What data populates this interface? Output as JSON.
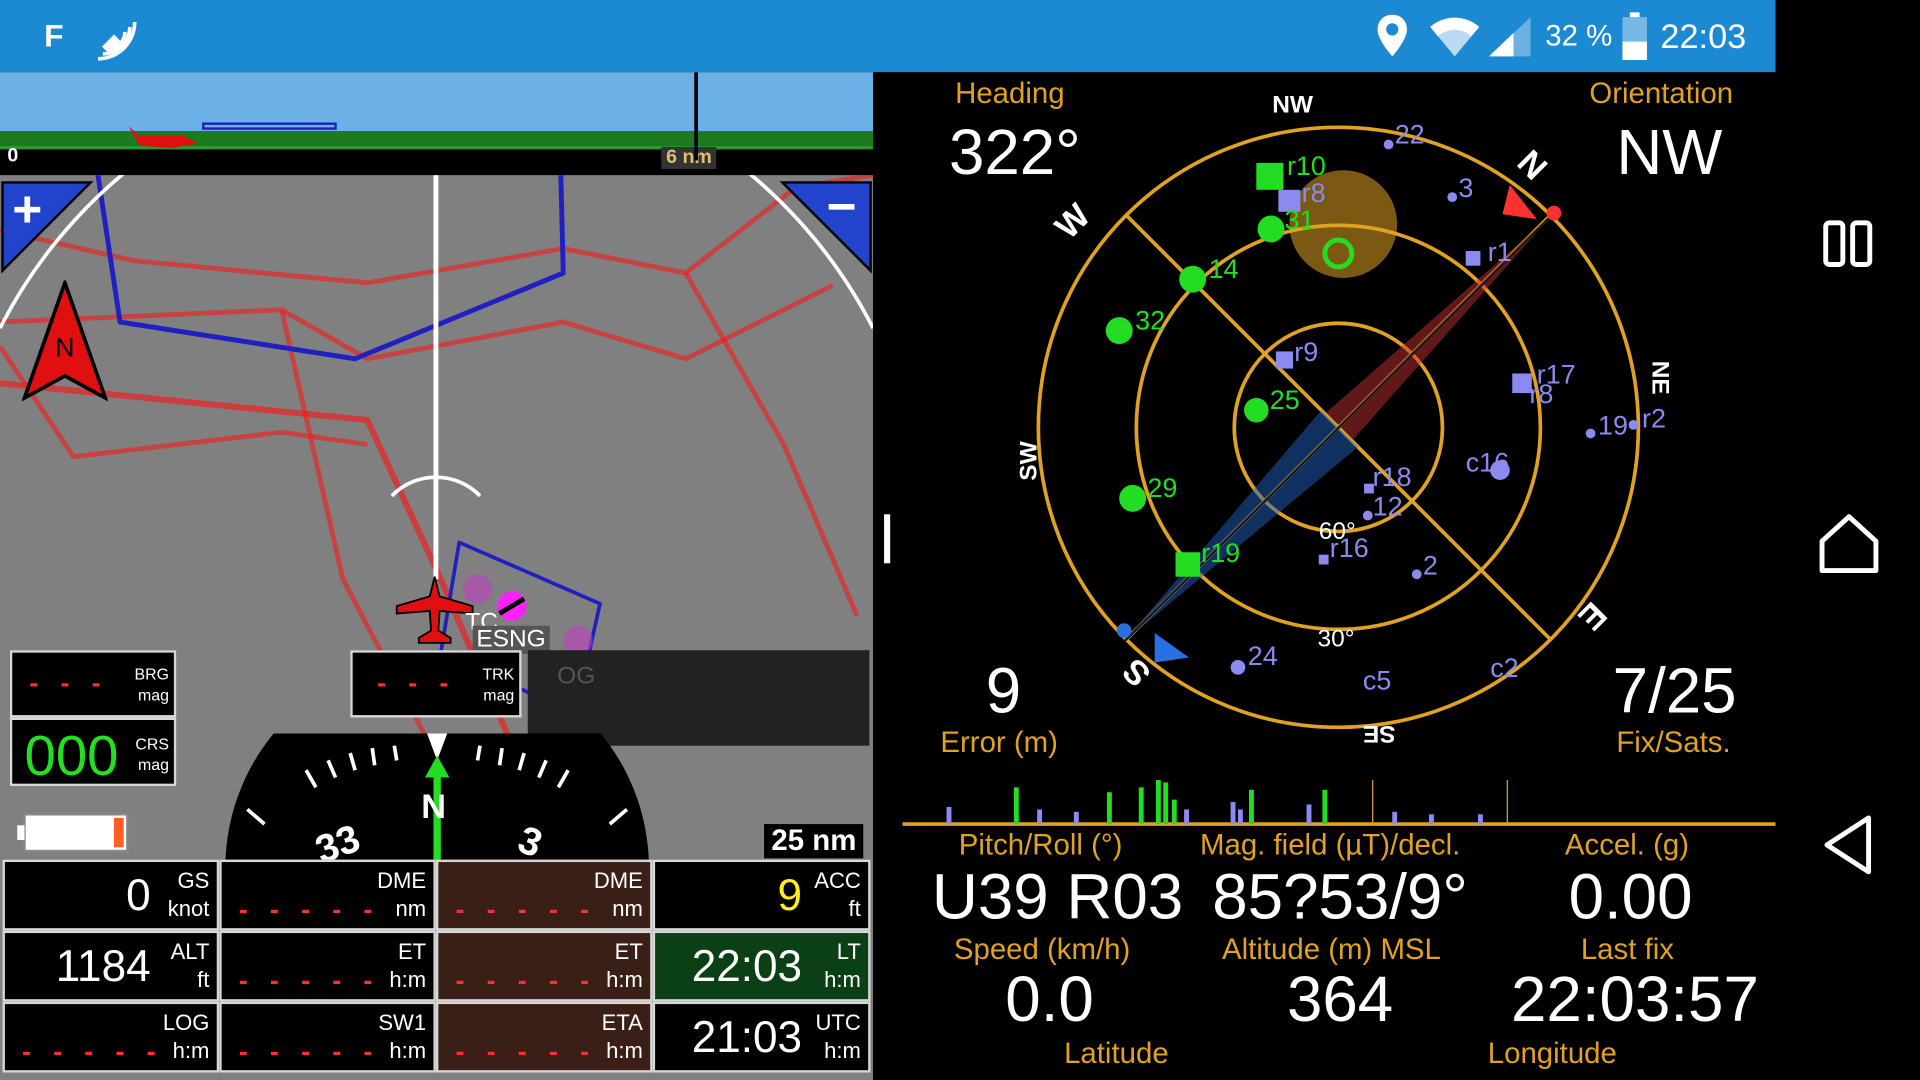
{
  "status_bar": {
    "left_letter": "F",
    "left_icon": "satellite-signal-icon",
    "icons": [
      "location-pin-icon",
      "wifi-icon",
      "cell-signal-icon",
      "battery-icon"
    ],
    "battery_percent": "32 %",
    "time": "22:03",
    "bg_color": "#1c89d3"
  },
  "map_panel": {
    "profile_left": "0",
    "profile_dist": "6 nm",
    "zoom_in": "+",
    "zoom_out": "−",
    "north_label": "N",
    "waypoint_label": "ESNG",
    "waypoint_label2": "TC",
    "waypoint_label3": "OG",
    "brg": {
      "value": "- - -",
      "u1": "BRG",
      "u2": "mag"
    },
    "trk": {
      "value": "- - -",
      "u1": "TRK",
      "u2": "mag"
    },
    "crs": {
      "value": "000",
      "u1": "CRS",
      "u2": "mag"
    },
    "compass_labels": [
      "33",
      "N",
      "3"
    ],
    "range": "25 nm",
    "battery_level": 0.1
  },
  "data_grid": [
    {
      "value": "0",
      "u1": "GS",
      "u2": "knot",
      "bg": "black"
    },
    {
      "value": "- - - - -",
      "u1": "DME",
      "u2": "nm",
      "bg": "black"
    },
    {
      "value": "- - - - -",
      "u1": "DME",
      "u2": "nm",
      "bg": "brown"
    },
    {
      "value": "9",
      "u1": "ACC",
      "u2": "ft",
      "bg": "black"
    },
    {
      "value": "1184",
      "u1": "ALT",
      "u2": "ft",
      "bg": "black"
    },
    {
      "value": "- - - - -",
      "u1": "ET",
      "u2": "h:m",
      "bg": "black"
    },
    {
      "value": "- - - - -",
      "u1": "ET",
      "u2": "h:m",
      "bg": "brown"
    },
    {
      "value": "22:03",
      "u1": "LT",
      "u2": "h:m",
      "bg": "green"
    },
    {
      "value": "- - - - -",
      "u1": "LOG",
      "u2": "h:m",
      "bg": "black"
    },
    {
      "value": "- - - - -",
      "u1": "SW1",
      "u2": "h:m",
      "bg": "black"
    },
    {
      "value": "- - - - -",
      "u1": "ETA",
      "u2": "h:m",
      "bg": "brown"
    },
    {
      "value": "21:03",
      "u1": "UTC",
      "u2": "h:m",
      "bg": "black"
    }
  ],
  "gps_panel": {
    "heading_label": "Heading",
    "heading_value": "322°",
    "orientation_label": "Orientation",
    "orientation_value": "NW",
    "error_value": "9",
    "error_label": "Error (m)",
    "fix_value": "7/25",
    "fix_label": "Fix/Sats.",
    "compass_dirs": [
      "N",
      "NE",
      "E",
      "SE",
      "S",
      "SW",
      "W",
      "NW"
    ],
    "ring_labels": [
      "60°",
      "30°"
    ],
    "sat_green": [
      "r10",
      "31",
      "14",
      "32",
      "25",
      "29",
      "r19"
    ],
    "sat_purple": [
      "22",
      "r8",
      "3",
      "r1",
      "r17",
      "r8",
      "19",
      "r2",
      "r9",
      "c16",
      "r18",
      "12",
      "r16",
      "2",
      "24",
      "c5",
      "c2"
    ],
    "pitch_roll_label": "Pitch/Roll (°)",
    "pitch_roll_value": "U39 R03",
    "mag_label": "Mag. field (µT)/decl.",
    "mag_value": "85?53/9°",
    "accel_label": "Accel. (g)",
    "accel_value": "0.00",
    "speed_label": "Speed (km/h)",
    "speed_value": "0.0",
    "alt_label": "Altitude (m) MSL",
    "alt_value": "364",
    "lastfix_label": "Last fix",
    "lastfix_value": "22:03:57",
    "lat_label": "Latitude",
    "lon_label": "Longitude",
    "accent_color": "#e0a220",
    "sat_green_color": "#22dd22",
    "sat_purple_color": "#8a8af0"
  },
  "nav_bar": {
    "icons": [
      "recents-icon",
      "home-icon",
      "back-icon"
    ]
  }
}
